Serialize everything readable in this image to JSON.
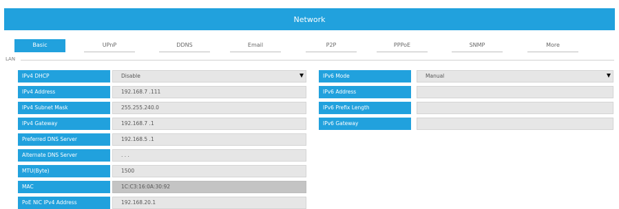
{
  "title": "Network",
  "tabs": [
    "Basic",
    "UPnP",
    "DDNS",
    "Email",
    "P2P",
    "PPPoE",
    "SNMP",
    "More"
  ],
  "section": "LAN",
  "left_fields": [
    {
      "label": "IPv4 DHCP",
      "value": "Disable"
    },
    {
      "label": "IPv4 Address",
      "value": "192.168.7  .111"
    },
    {
      "label": "IPv4 Subnet Mask",
      "value": "255.255.240.0"
    },
    {
      "label": "IPv4 Gateway",
      "value": "192.168.7  .1"
    },
    {
      "label": "Preferred DNS Server",
      "value": "192.168.5  .1"
    },
    {
      "label": "Alternate DNS Server",
      "value": ".  .  ."
    },
    {
      "label": "MTU(Byte)",
      "value": "1500"
    },
    {
      "label": "MAC",
      "value": "1C:C3:16:0A:30:92"
    },
    {
      "label": "PoE NIC IPv4 Address",
      "value": "192.168.20.1"
    }
  ],
  "right_fields": [
    {
      "label": "IPv6 Mode",
      "value": "Manual"
    },
    {
      "label": "IPv6 Address",
      "value": ""
    },
    {
      "label": "IPv6 Prefix Length",
      "value": ""
    },
    {
      "label": "IPv6 Gateway",
      "value": ""
    }
  ],
  "icons": {
    "dropdown": "caret-down-icon"
  }
}
